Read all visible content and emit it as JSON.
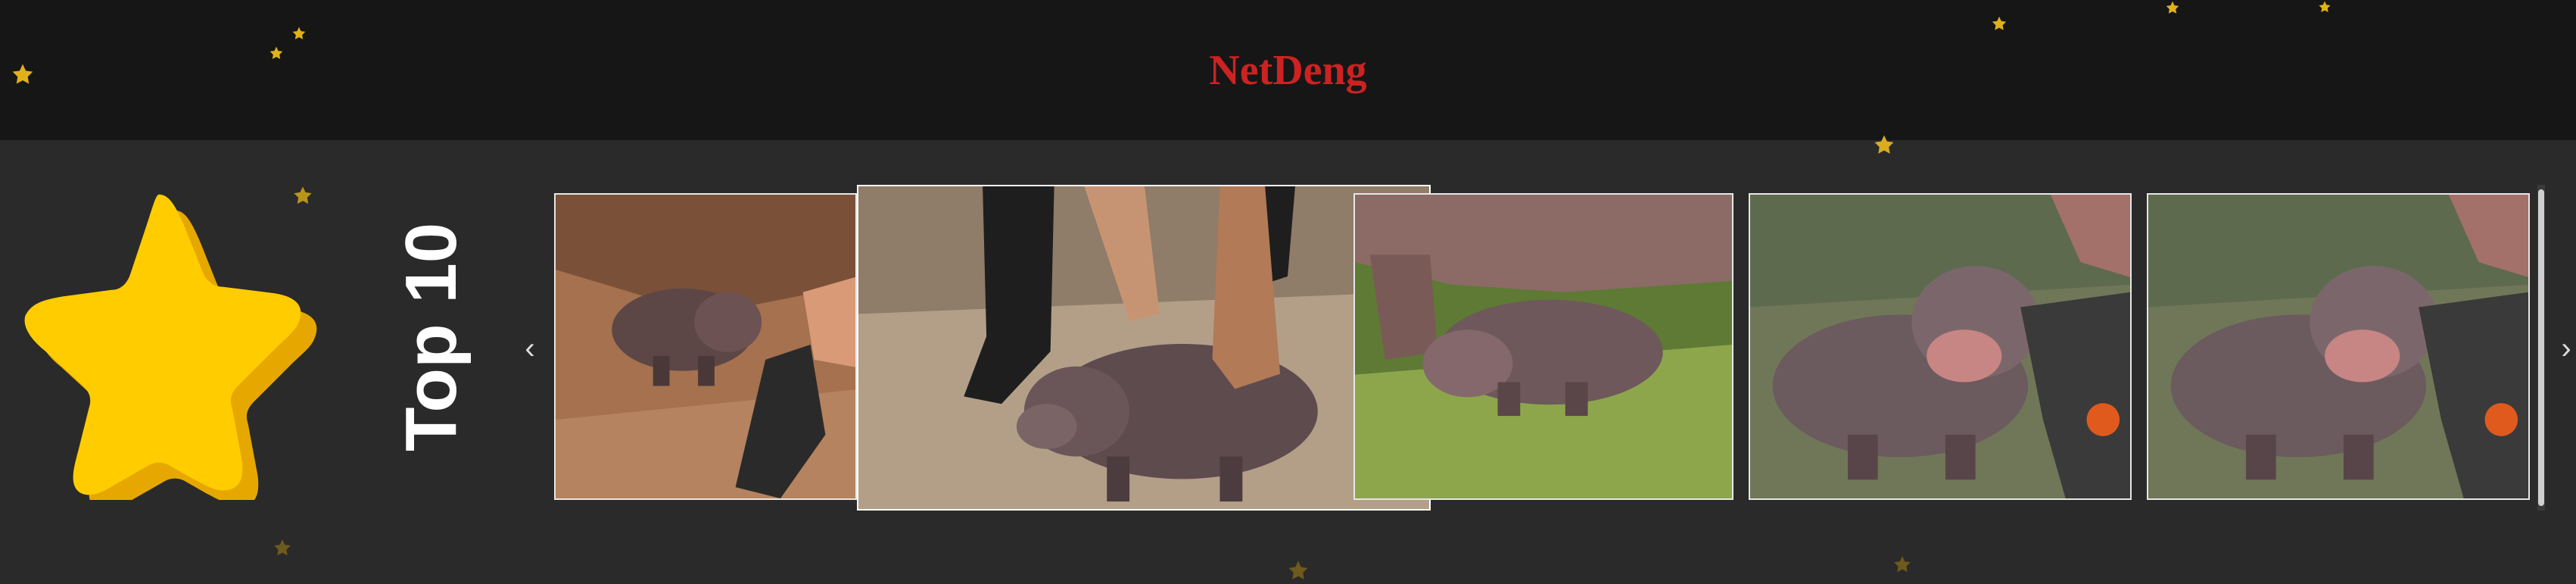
{
  "header": {
    "title": "NetDeng"
  },
  "section": {
    "title": "Top 10"
  },
  "carousel": {
    "prev_arrow": "‹",
    "next_arrow": "›",
    "items": [
      {
        "name": "thumb-1"
      },
      {
        "name": "thumb-2-highlighted"
      },
      {
        "name": "thumb-3"
      },
      {
        "name": "thumb-4"
      },
      {
        "name": "thumb-5"
      }
    ]
  },
  "colors": {
    "accent": "#cc2222",
    "star": "#ffcc00",
    "bg": "#2a2a2a",
    "header_bg": "#161616"
  },
  "icons": [
    "star-icon",
    "chevron-left-icon",
    "chevron-right-icon"
  ]
}
